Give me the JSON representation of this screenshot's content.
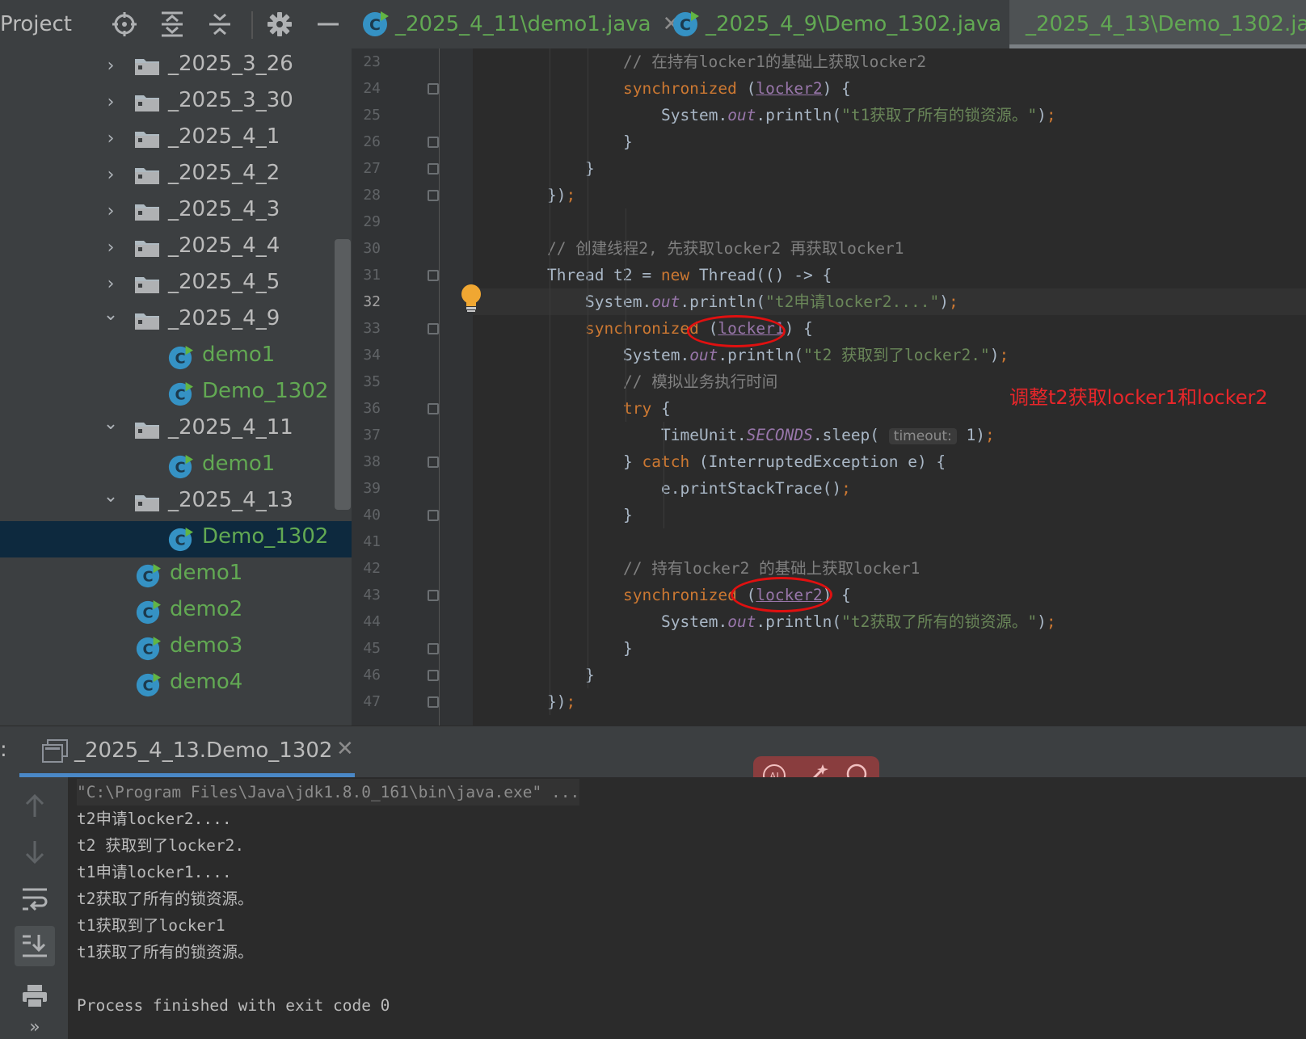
{
  "project_panel": {
    "title": "Project",
    "tree": [
      {
        "label": "_2025_3_26",
        "kind": "folder",
        "expanded": false
      },
      {
        "label": "_2025_3_30",
        "kind": "folder",
        "expanded": false
      },
      {
        "label": "_2025_4_1",
        "kind": "folder",
        "expanded": false
      },
      {
        "label": "_2025_4_2",
        "kind": "folder",
        "expanded": false
      },
      {
        "label": "_2025_4_3",
        "kind": "folder",
        "expanded": false
      },
      {
        "label": "_2025_4_4",
        "kind": "folder",
        "expanded": false
      },
      {
        "label": "_2025_4_5",
        "kind": "folder",
        "expanded": false
      },
      {
        "label": "_2025_4_9",
        "kind": "folder",
        "expanded": true
      },
      {
        "label": "demo1",
        "kind": "class"
      },
      {
        "label": "Demo_1302",
        "kind": "class"
      },
      {
        "label": "_2025_4_11",
        "kind": "folder",
        "expanded": true
      },
      {
        "label": "demo1",
        "kind": "class"
      },
      {
        "label": "_2025_4_13",
        "kind": "folder",
        "expanded": true
      },
      {
        "label": "Demo_1302",
        "kind": "class",
        "selected": true
      },
      {
        "label": "demo1",
        "kind": "class"
      },
      {
        "label": "demo2",
        "kind": "class"
      },
      {
        "label": "demo3",
        "kind": "class"
      },
      {
        "label": "demo4",
        "kind": "class"
      }
    ]
  },
  "tabs": [
    {
      "label": "_2025_4_11\\demo1.java",
      "close": "✕"
    },
    {
      "label": "_2025_4_9\\Demo_1302.java",
      "close": "✕"
    },
    {
      "label": "_2025_4_13\\Demo_1302.ja",
      "close": ""
    }
  ],
  "editor": {
    "current_line": 32,
    "lines": [
      {
        "n": 23,
        "tokens": [
          [
            "cm",
            "// 在持有locker1的基础上获取locker2"
          ]
        ]
      },
      {
        "n": 24,
        "tokens": [
          [
            "kw",
            "synchronized"
          ],
          [
            "plain",
            " ("
          ],
          [
            "var",
            "locker2"
          ],
          [
            "plain",
            ") {"
          ]
        ]
      },
      {
        "n": 25,
        "tokens": [
          [
            "plain",
            "System."
          ],
          [
            "field",
            "out"
          ],
          [
            "plain",
            ".println("
          ],
          [
            "str",
            "\"t1获取了所有的锁资源。\""
          ],
          [
            "plain",
            ")"
          ],
          [
            "punc",
            ";"
          ]
        ]
      },
      {
        "n": 26,
        "tokens": [
          [
            "plain",
            "}"
          ]
        ]
      },
      {
        "n": 27,
        "tokens": [
          [
            "plain",
            "}"
          ]
        ]
      },
      {
        "n": 28,
        "tokens": [
          [
            "plain",
            "})"
          ],
          [
            "punc",
            ";"
          ]
        ]
      },
      {
        "n": 29,
        "tokens": []
      },
      {
        "n": 30,
        "tokens": [
          [
            "cm",
            "// 创建线程2, 先获取locker2 再获取locker1"
          ]
        ]
      },
      {
        "n": 31,
        "tokens": [
          [
            "plain",
            "Thread t2 = "
          ],
          [
            "kw",
            "new"
          ],
          [
            "plain",
            " Thread(() -> {"
          ]
        ]
      },
      {
        "n": 32,
        "tokens": [
          [
            "plain",
            "System."
          ],
          [
            "field",
            "out"
          ],
          [
            "plain",
            ".println("
          ],
          [
            "str",
            "\"t2申请locker2....\""
          ],
          [
            "plain",
            ")"
          ],
          [
            "punc",
            ";"
          ]
        ]
      },
      {
        "n": 33,
        "tokens": [
          [
            "kw",
            "synchronized"
          ],
          [
            "plain",
            " ("
          ],
          [
            "var",
            "locker1"
          ],
          [
            "plain",
            ") {"
          ]
        ]
      },
      {
        "n": 34,
        "tokens": [
          [
            "plain",
            "System."
          ],
          [
            "field",
            "out"
          ],
          [
            "plain",
            ".println("
          ],
          [
            "str",
            "\"t2 获取到了locker2.\""
          ],
          [
            "plain",
            ")"
          ],
          [
            "punc",
            ";"
          ]
        ]
      },
      {
        "n": 35,
        "tokens": [
          [
            "cm",
            "// 模拟业务执行时间"
          ]
        ]
      },
      {
        "n": 36,
        "tokens": [
          [
            "kw",
            "try"
          ],
          [
            "plain",
            " {"
          ]
        ]
      },
      {
        "n": 37,
        "tokens": [
          [
            "plain",
            "TimeUnit."
          ],
          [
            "field",
            "SECONDS"
          ],
          [
            "plain",
            ".sleep( "
          ],
          [
            "hint",
            "timeout:"
          ],
          [
            "plain",
            " 1)"
          ],
          [
            "punc",
            ";"
          ]
        ]
      },
      {
        "n": 38,
        "tokens": [
          [
            "plain",
            "} "
          ],
          [
            "kw",
            "catch"
          ],
          [
            "plain",
            " (InterruptedException e) {"
          ]
        ]
      },
      {
        "n": 39,
        "tokens": [
          [
            "plain",
            "e.printStackTrace()"
          ],
          [
            "punc",
            ";"
          ]
        ]
      },
      {
        "n": 40,
        "tokens": [
          [
            "plain",
            "}"
          ]
        ]
      },
      {
        "n": 41,
        "tokens": []
      },
      {
        "n": 42,
        "tokens": [
          [
            "cm",
            "// 持有locker2 的基础上获取locker1"
          ]
        ]
      },
      {
        "n": 43,
        "tokens": [
          [
            "kw",
            "synchronized"
          ],
          [
            "plain",
            " ("
          ],
          [
            "var",
            "locker2"
          ],
          [
            "plain",
            ") {"
          ]
        ]
      },
      {
        "n": 44,
        "tokens": [
          [
            "plain",
            "System."
          ],
          [
            "field",
            "out"
          ],
          [
            "plain",
            ".println("
          ],
          [
            "str",
            "\"t2获取了所有的锁资源。\""
          ],
          [
            "plain",
            ")"
          ],
          [
            "punc",
            ";"
          ]
        ]
      },
      {
        "n": 45,
        "tokens": [
          [
            "plain",
            "}"
          ]
        ]
      },
      {
        "n": 46,
        "tokens": [
          [
            "plain",
            "}"
          ]
        ]
      },
      {
        "n": 47,
        "tokens": [
          [
            "plain",
            "})"
          ],
          [
            "punc",
            ";"
          ]
        ]
      }
    ],
    "annotation": "调整t2获取locker1和locker2"
  },
  "run_panel": {
    "prefix": ":",
    "tab_label": "_2025_4_13.Demo_1302",
    "tab_close": "✕",
    "output": [
      "\"C:\\Program Files\\Java\\jdk1.8.0_161\\bin\\java.exe\" ...",
      "t2申请locker2....",
      "t2 获取到了locker2.",
      "t1申请locker1....",
      "t2获取了所有的锁资源。",
      "t1获取到了locker1",
      "t1获取了所有的锁资源。",
      "",
      "Process finished with exit code 0"
    ]
  },
  "colors": {
    "accent": "#4a88c7",
    "class_green": "#62a953",
    "keyword": "#cc7832",
    "string": "#6a8759",
    "annotation_red": "#e8262a"
  }
}
